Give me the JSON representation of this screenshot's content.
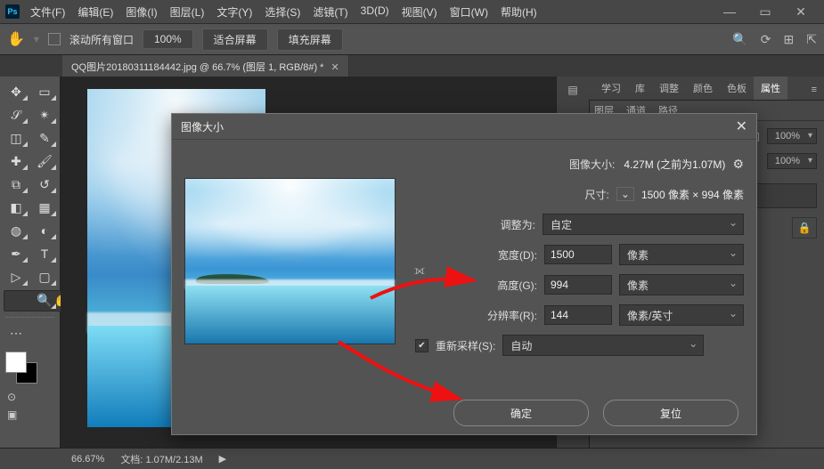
{
  "app": {
    "logo": "Ps"
  },
  "menu": {
    "file": "文件(F)",
    "edit": "编辑(E)",
    "image": "图像(I)",
    "layer": "图层(L)",
    "type": "文字(Y)",
    "select": "选择(S)",
    "filter": "滤镜(T)",
    "threeD": "3D(D)",
    "view": "视图(V)",
    "window": "窗口(W)",
    "help": "帮助(H)"
  },
  "optbar": {
    "scroll_all": "滚动所有窗口",
    "zoom": "100%",
    "fit": "适合屏幕",
    "fill": "填充屏幕"
  },
  "doc_tab": {
    "title": "QQ图片20180311184442.jpg @ 66.7% (图层 1, RGB/8#) *"
  },
  "status": {
    "zoom": "66.67%",
    "doc_label": "文档:",
    "doc_val": "1.07M/2.13M"
  },
  "panels": {
    "tabs": {
      "learn": "学习",
      "library": "库",
      "adjust": "调整",
      "color": "颜色",
      "swatch": "色板",
      "properties": "属性"
    },
    "subtabs": {
      "layers": "图层",
      "channels": "通道",
      "paths": "路径"
    },
    "rows": {
      "pct1": "100%",
      "pct2": "100%"
    }
  },
  "dialog": {
    "title": "图像大小",
    "size_label": "图像大小:",
    "size_value": "4.27M",
    "size_prev": "(之前为1.07M)",
    "dimensions_label": "尺寸:",
    "dimensions_value": "1500 像素 × 994 像素",
    "fit_label": "调整为:",
    "fit_value": "自定",
    "width_label": "宽度(D):",
    "width_value": "1500",
    "height_label": "高度(G):",
    "height_value": "994",
    "unit_px": "像素",
    "res_label": "分辨率(R):",
    "res_value": "144",
    "res_unit": "像素/英寸",
    "resample_label": "重新采样(S):",
    "resample_value": "自动",
    "ok": "确定",
    "reset": "复位"
  }
}
